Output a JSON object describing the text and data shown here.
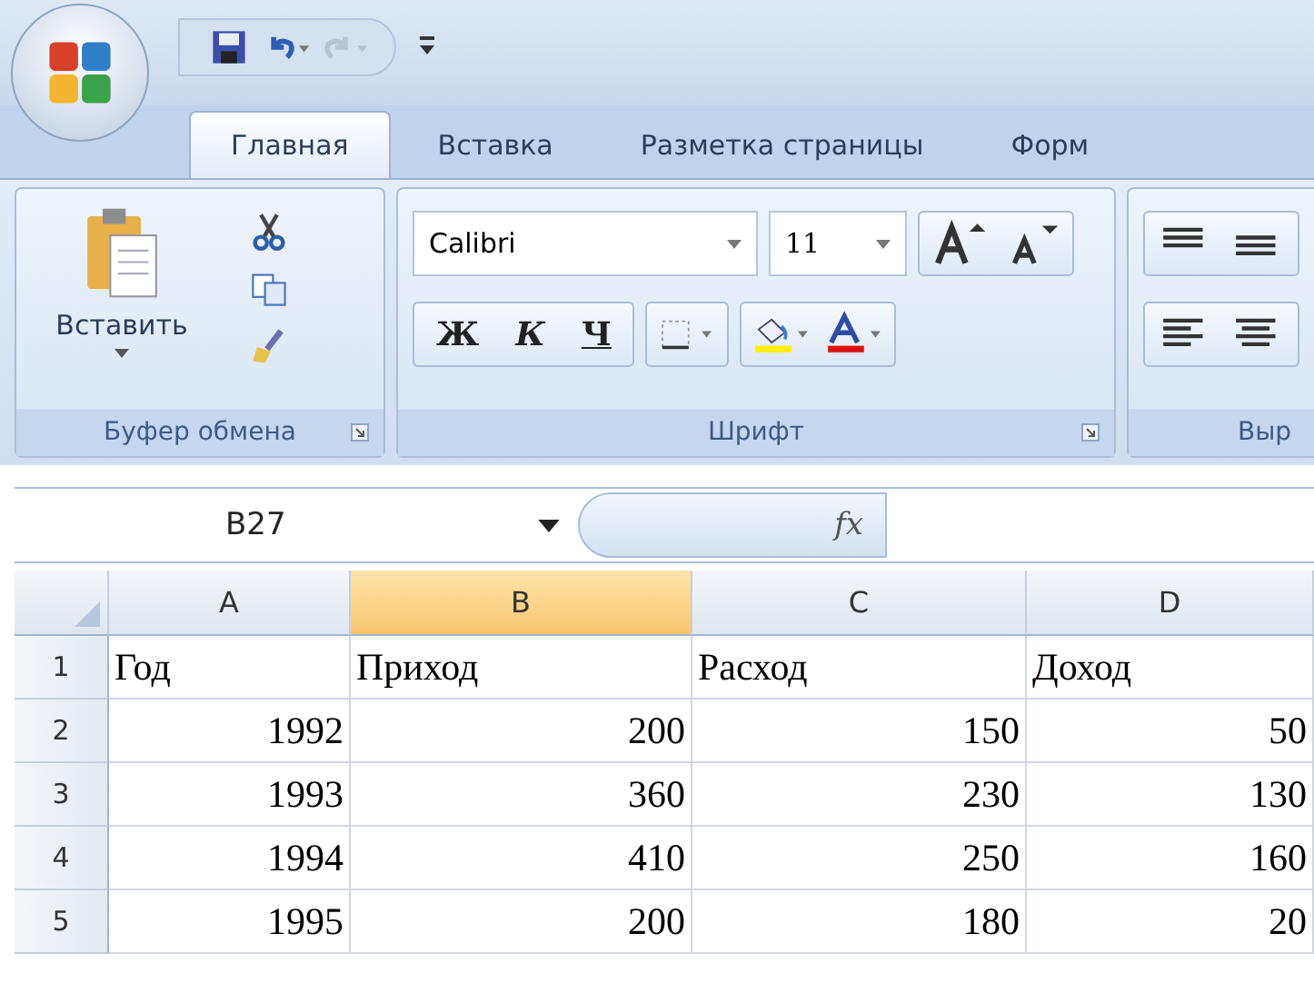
{
  "tabs": [
    {
      "label": "Главная",
      "selected": true
    },
    {
      "label": "Вставка",
      "selected": false
    },
    {
      "label": "Разметка страницы",
      "selected": false
    },
    {
      "label": "Форм",
      "selected": false
    }
  ],
  "clipboard": {
    "paste": "Вставить",
    "label": "Буфер обмена"
  },
  "font": {
    "name": "Calibri",
    "size": "11",
    "bold": "Ж",
    "italic": "К",
    "underline": "Ч",
    "label": "Шрифт"
  },
  "alignment": {
    "label": "Выр"
  },
  "formula_bar": {
    "name_box": "B27",
    "fx": "fx"
  },
  "columns": [
    {
      "label": "A",
      "selected": false
    },
    {
      "label": "B",
      "selected": true
    },
    {
      "label": "C",
      "selected": false
    },
    {
      "label": "D",
      "selected": false
    }
  ],
  "rows": [
    {
      "number": "1",
      "kind": "text",
      "cells": [
        "Год",
        "Приход",
        "Расход",
        "Доход"
      ]
    },
    {
      "number": "2",
      "kind": "number",
      "cells": [
        "1992",
        "200",
        "150",
        "50"
      ]
    },
    {
      "number": "3",
      "kind": "number",
      "cells": [
        "1993",
        "360",
        "230",
        "130"
      ]
    },
    {
      "number": "4",
      "kind": "number",
      "cells": [
        "1994",
        "410",
        "250",
        "160"
      ]
    },
    {
      "number": "5",
      "kind": "number",
      "cells": [
        "1995",
        "200",
        "180",
        "20"
      ]
    }
  ]
}
